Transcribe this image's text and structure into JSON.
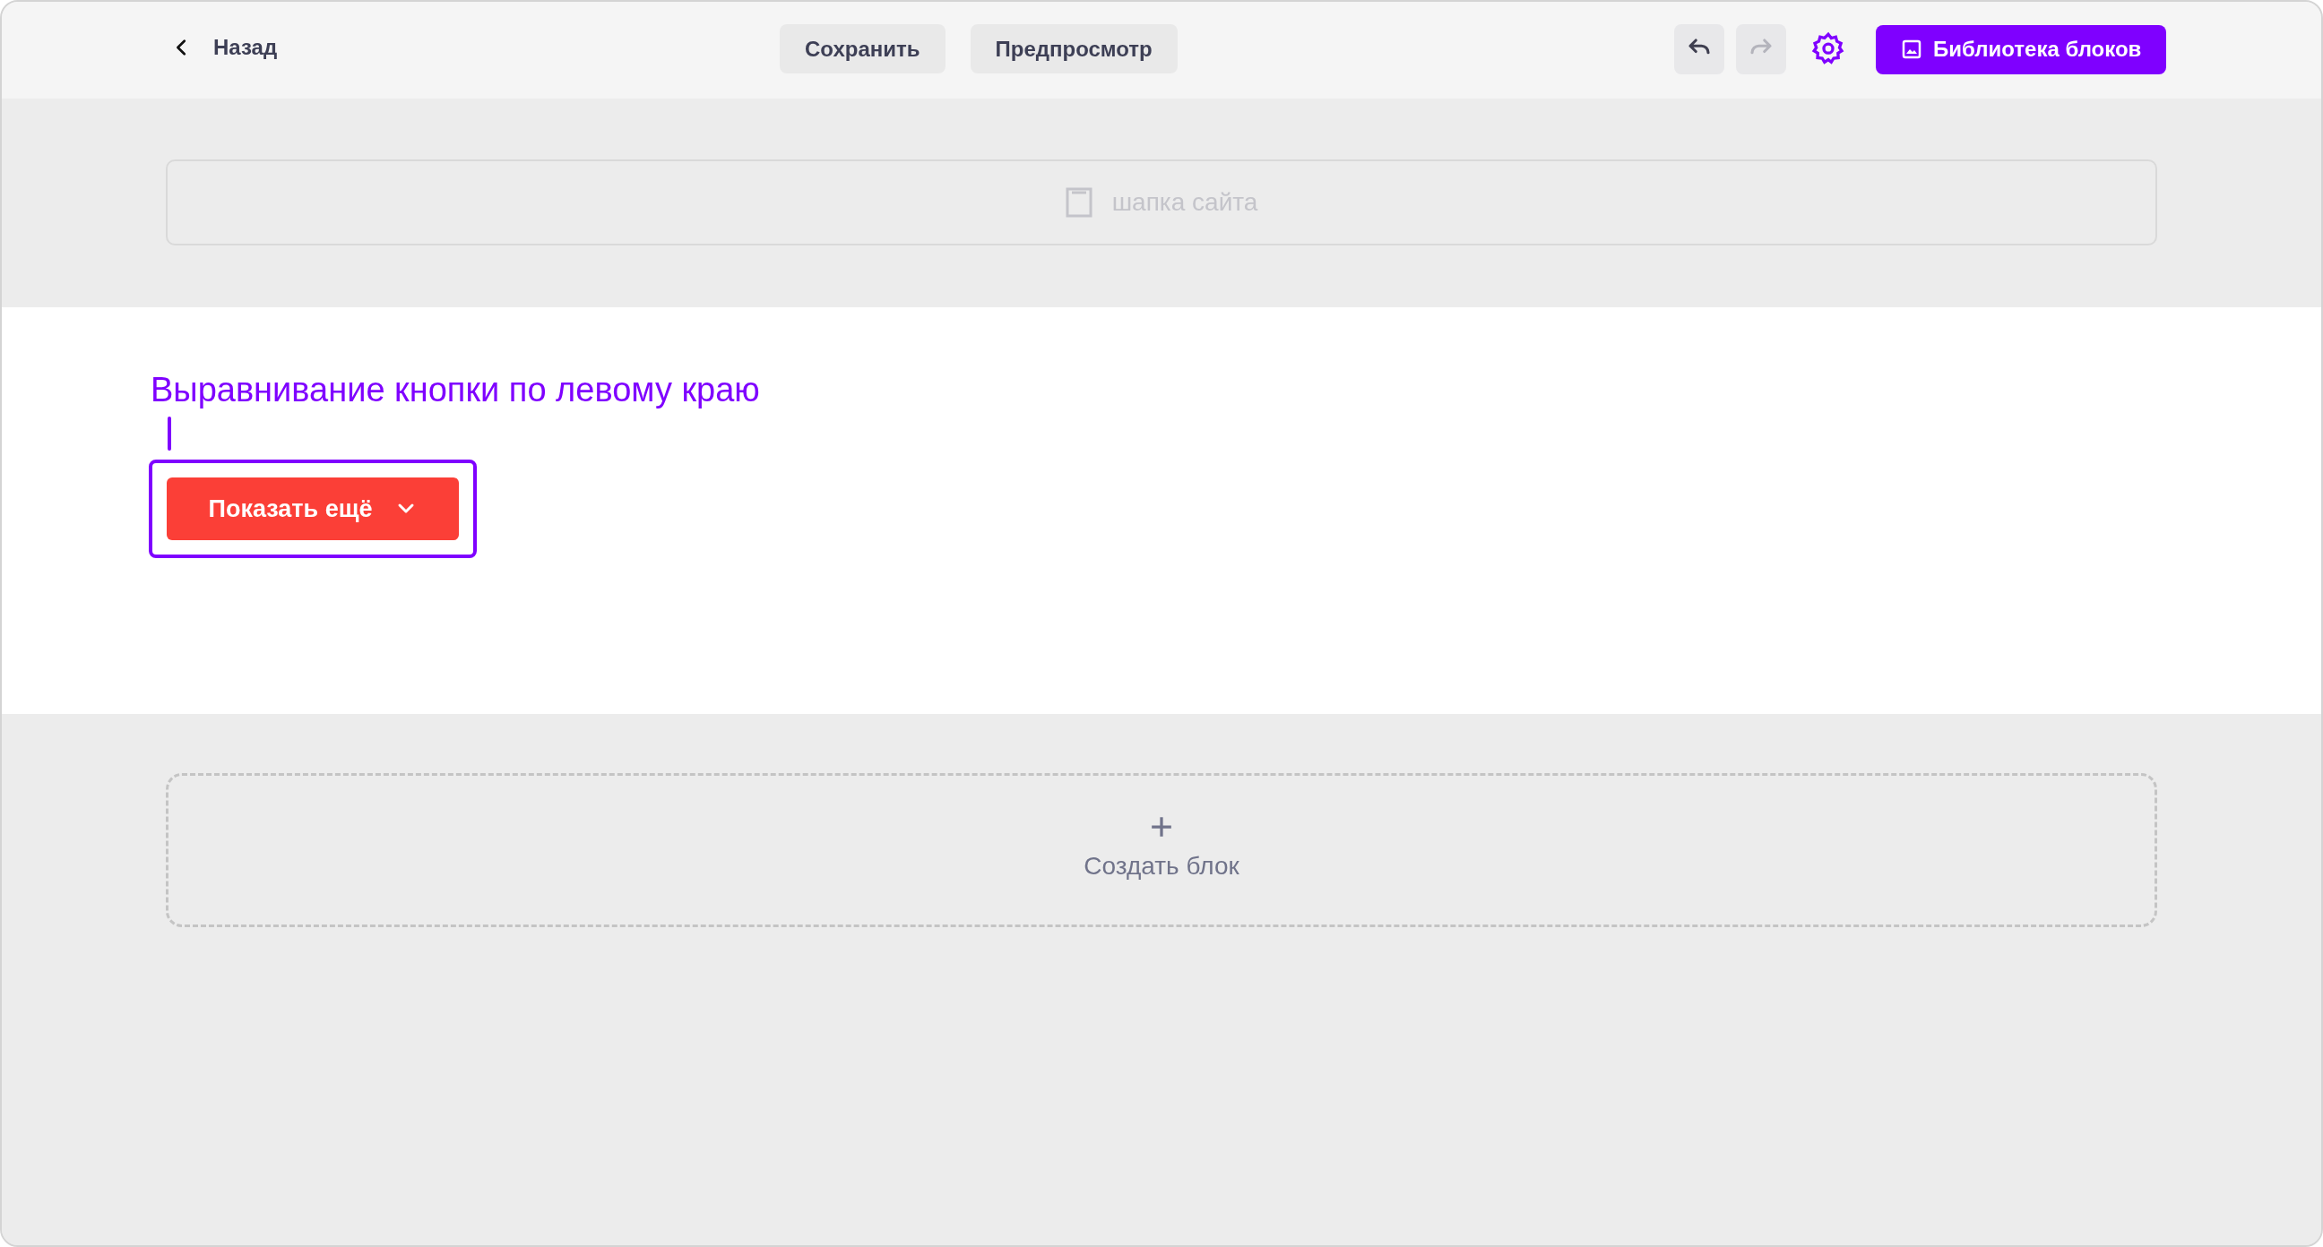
{
  "toolbar": {
    "back": "Назад",
    "buttons": [
      "Сохранить",
      "Предпросмотр"
    ],
    "history": [
      {
        "kind": "undo",
        "disabled": false
      },
      {
        "kind": "redo",
        "disabled": true
      }
    ],
    "library": "Библиотека блоков"
  },
  "header_block": {
    "label": "шапка сайта"
  },
  "content": {
    "annotation": "Выравнивание кнопки по левому краю",
    "button": "Показать ещё"
  },
  "create_block": {
    "label": "Создать блок"
  }
}
